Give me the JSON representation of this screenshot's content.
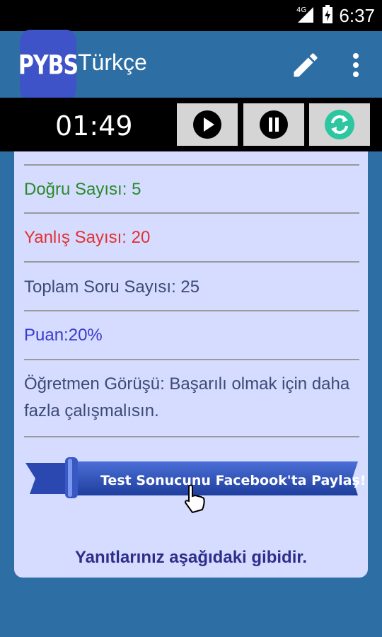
{
  "status_bar": {
    "network": "4G",
    "time": "6:37"
  },
  "app_bar": {
    "logo": "PYBS",
    "title": "Türkçe",
    "edit_icon": "pencil-icon",
    "menu_icon": "more-vertical-icon"
  },
  "timer": {
    "time": "01:49",
    "controls": [
      "play-icon",
      "pause-icon",
      "refresh-icon"
    ]
  },
  "results": {
    "correct": "Doğru Sayısı: 5",
    "wrong": "Yanlış Sayısı: 20",
    "total": "Toplam Soru Sayısı: 25",
    "score": "Puan:20%",
    "teacher": "Öğretmen Görüşü: Başarılı olmak için daha fazla çalışmalısın."
  },
  "share": {
    "label": "Test Sonucunu Facebook'ta Paylaş!"
  },
  "answers_heading": "Yanıtlarınız aşağıdaki gibidir.",
  "colors": {
    "app_bar": "#2d6fa5",
    "card": "#d5dcff",
    "correct": "#2a8a2a",
    "wrong": "#e33131",
    "score": "#3a3ad0"
  }
}
